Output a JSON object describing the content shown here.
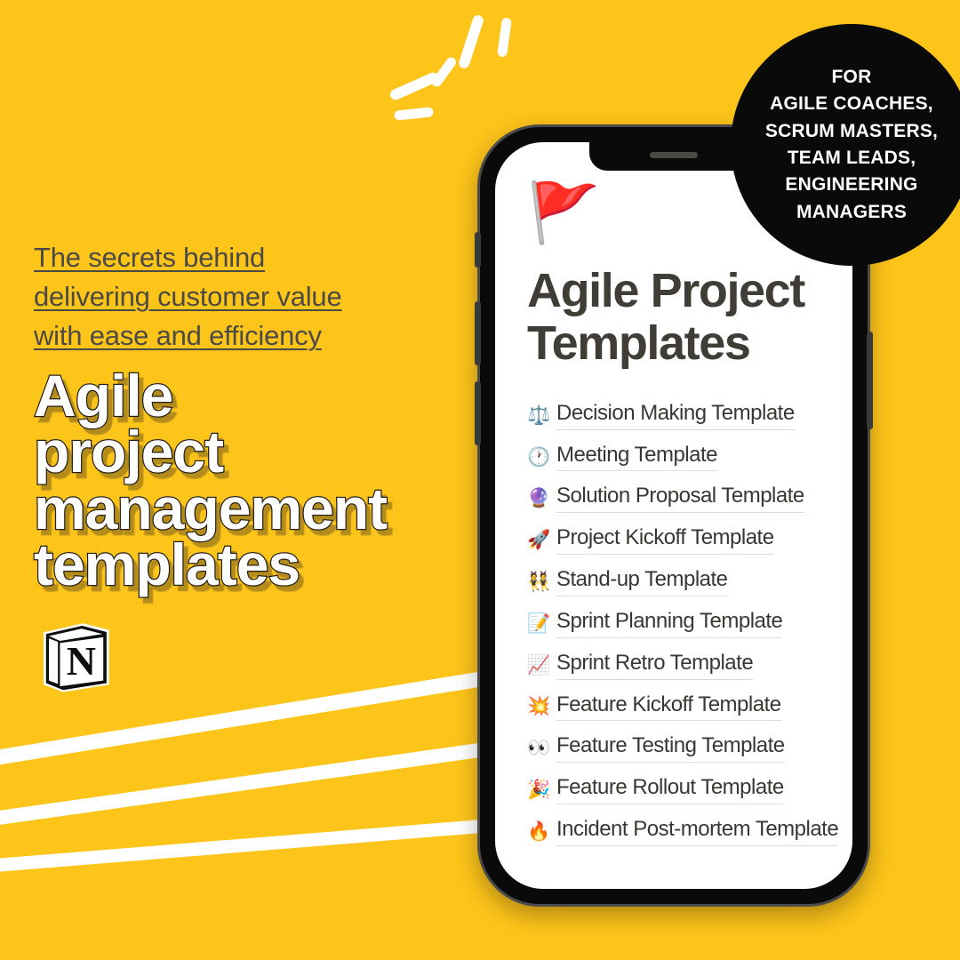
{
  "theme": {
    "background_color": "#FDC41A",
    "badge_color": "#0A0A0A",
    "headline_color": "#FFFFFF",
    "subtitle_color": "#4C4A44",
    "screen_title_color": "#403D37",
    "list_text_color": "#3A3733",
    "stroke_color": "#FFFFFF"
  },
  "left": {
    "subtitle_line1": "The secrets behind ",
    "subtitle_line2": "delivering customer value",
    "subtitle_line3": "with ease and efficiency",
    "headline_line1": "Agile",
    "headline_line2": "project",
    "headline_line3": "management",
    "headline_line4": "templates",
    "logo_name": "notion-logo",
    "logo_letter": "N"
  },
  "badge": {
    "line1": "FOR",
    "line2": "AGILE COACHES,",
    "line3": "SCRUM MASTERS,",
    "line4": "TEAM LEADS,",
    "line5": "ENGINEERING",
    "line6": "MANAGERS"
  },
  "phone": {
    "flag_emoji": "🚩",
    "screen_title_line1": "Agile Project",
    "screen_title_line2": "Templates",
    "templates": [
      {
        "emoji": "⚖️",
        "icon_name": "balance-scale-icon",
        "label": "Decision Making Template"
      },
      {
        "emoji": "🕐",
        "icon_name": "clock-icon",
        "label": "Meeting Template"
      },
      {
        "emoji": "🔮",
        "icon_name": "crystal-ball-icon",
        "label": "Solution Proposal Template"
      },
      {
        "emoji": "🚀",
        "icon_name": "rocket-icon",
        "label": "Project Kickoff Template"
      },
      {
        "emoji": "👯",
        "icon_name": "people-with-bunny-ears-icon",
        "label": "Stand-up Template"
      },
      {
        "emoji": "📝",
        "icon_name": "memo-icon",
        "label": "Sprint Planning Template"
      },
      {
        "emoji": "📈",
        "icon_name": "chart-increasing-icon",
        "label": "Sprint Retro Template"
      },
      {
        "emoji": "💥",
        "icon_name": "collision-icon",
        "label": "Feature Kickoff Template"
      },
      {
        "emoji": "👀",
        "icon_name": "eyes-icon",
        "label": "Feature Testing Template"
      },
      {
        "emoji": "🎉",
        "icon_name": "party-popper-icon",
        "label": "Feature Rollout Template"
      },
      {
        "emoji": "🔥",
        "icon_name": "fire-icon",
        "label": "Incident Post-mortem Template"
      }
    ]
  }
}
